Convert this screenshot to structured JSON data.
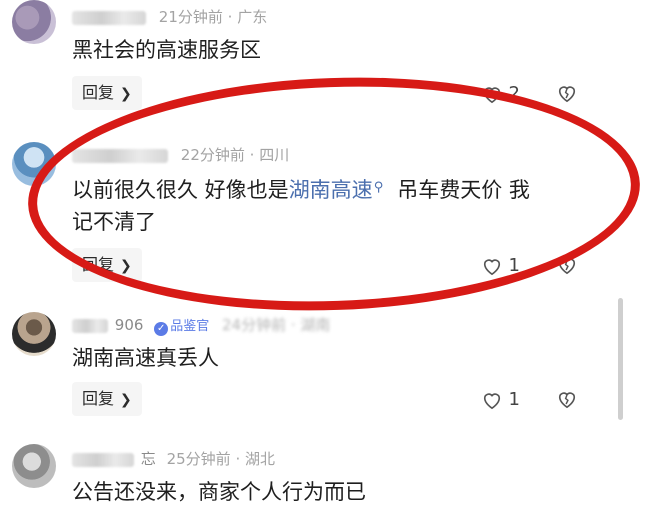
{
  "comments": [
    {
      "meta_time": "21分钟前",
      "meta_location": "广东",
      "text": "黑社会的高速服务区",
      "reply_label": "回复",
      "like_count": "2"
    },
    {
      "meta_time": "22分钟前",
      "meta_location": "四川",
      "text_before_link": "以前很久很久 好像也是",
      "link_text": "湖南高速",
      "text_after_link": "吊车费天价 我",
      "text_line2": "记不清了",
      "reply_label": "回复",
      "like_count": "1"
    },
    {
      "name_suffix": "906",
      "badge": "品鉴官",
      "meta_time": "24分钟前",
      "meta_location": "湖南",
      "text": "湖南高速真丢人",
      "reply_label": "回复",
      "like_count": "1"
    },
    {
      "name_suffix": "忘",
      "meta_time": "25分钟前",
      "meta_location": "湖北",
      "text": "公告还没来，商家个人行为而已"
    }
  ],
  "highlight_color": "#d71a16",
  "link_color": "#4b6fae",
  "icons": {
    "like": "heart-outline-icon",
    "dislike": "broken-heart-icon",
    "search": "search-icon",
    "chevron": "chevron-right-icon"
  }
}
